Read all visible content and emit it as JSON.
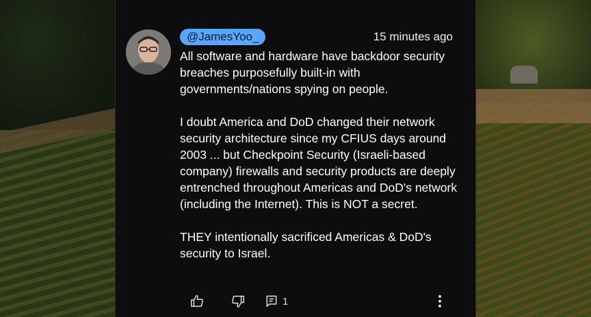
{
  "comment": {
    "author": "@JamesYoo_",
    "timestamp": "15 minutes ago",
    "paragraphs": [
      "All software and hardware have backdoor security breaches  purposefully built-in with governments/nations spying on people.",
      "I doubt America and DoD changed their network security architecture since my CFIUS days around 2003 ... but Checkpoint Security (Israeli-based company) firewalls and security products are deeply entrenched throughout Americas  and DoD's network (including the Internet).  This is NOT a secret.",
      "THEY intentionally sacrificed Americas & DoD's security to Israel."
    ],
    "reply_count": "1"
  },
  "icons": {
    "like": "thumbs-up-icon",
    "dislike": "thumbs-down-icon",
    "reply": "comment-icon",
    "more": "more-vertical-icon"
  },
  "colors": {
    "panel_bg": "#0d0d0f",
    "handle_bg": "#5aa6ff",
    "text": "#ffffff"
  }
}
